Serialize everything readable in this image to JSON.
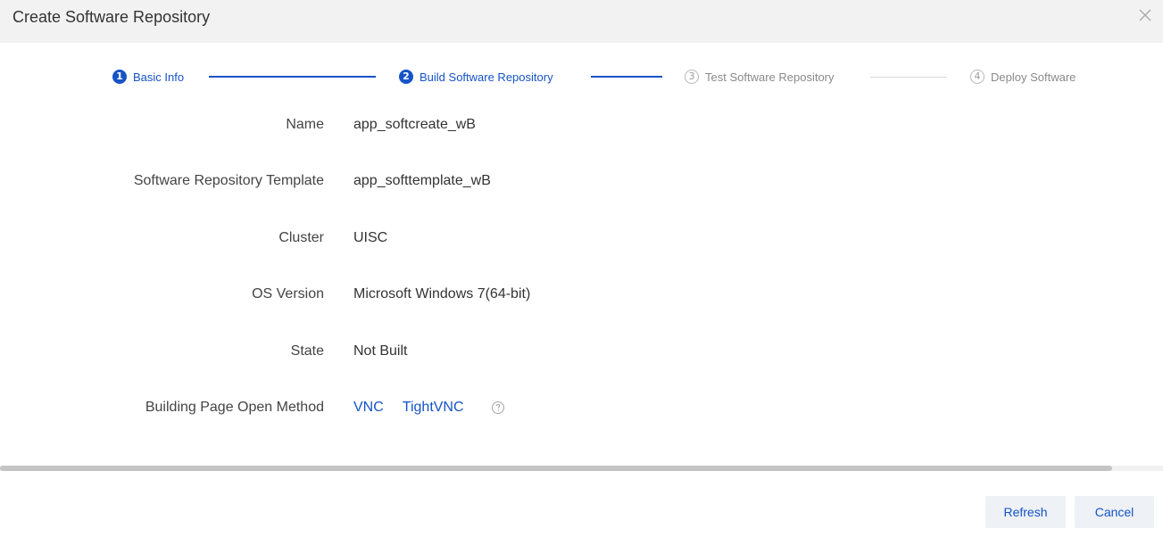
{
  "dialog": {
    "title": "Create Software Repository",
    "close_icon": "close-icon"
  },
  "steps": [
    {
      "number": "1",
      "label": "Basic Info",
      "state": "done"
    },
    {
      "number": "2",
      "label": "Build Software Repository",
      "state": "active"
    },
    {
      "number": "3",
      "label": "Test Software Repository",
      "state": "pending"
    },
    {
      "number": "4",
      "label": "Deploy Software",
      "state": "pending"
    }
  ],
  "form": {
    "name": {
      "label": "Name",
      "value": "app_softcreate_wB"
    },
    "template": {
      "label": "Software Repository Template",
      "value": "app_softtemplate_wB"
    },
    "cluster": {
      "label": "Cluster",
      "value": "UISC"
    },
    "os_version": {
      "label": "OS Version",
      "value": "Microsoft Windows 7(64-bit)"
    },
    "state": {
      "label": "State",
      "value": "Not Built"
    },
    "open_method": {
      "label": "Building Page Open Method",
      "options": [
        "VNC",
        "TightVNC"
      ],
      "help_icon": "help-circle-icon"
    }
  },
  "footer": {
    "refresh_label": "Refresh",
    "cancel_label": "Cancel"
  },
  "colors": {
    "accent": "#1553c7",
    "header_bg": "#f2f2f2",
    "button_bg": "#eef1f5",
    "pending": "#b8b8b8"
  }
}
